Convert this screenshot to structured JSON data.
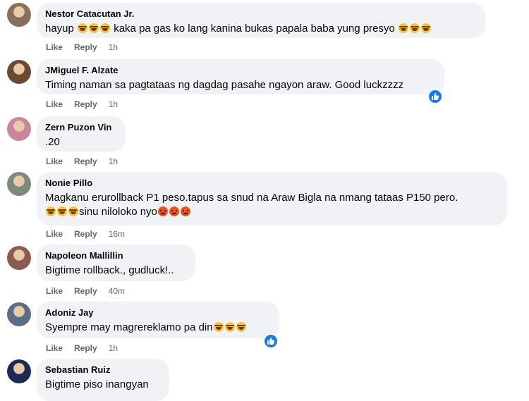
{
  "comments": [
    {
      "author": "Nestor Catacutan Jr.",
      "segments": [
        {
          "type": "text",
          "value": "hayup "
        },
        {
          "type": "emoji",
          "value": "laugh"
        },
        {
          "type": "emoji",
          "value": "laugh"
        },
        {
          "type": "emoji",
          "value": "laugh"
        },
        {
          "type": "text",
          "value": " kaka pa gas ko lang kanina bukas papala baba yung presyo "
        },
        {
          "type": "emoji",
          "value": "laugh"
        },
        {
          "type": "emoji",
          "value": "laugh"
        },
        {
          "type": "emoji",
          "value": "laugh"
        }
      ],
      "like_label": "Like",
      "reply_label": "Reply",
      "time": "1h",
      "reaction": null,
      "avatar_color": "#8a6e5c"
    },
    {
      "author": "JMiguel F. Alzate",
      "segments": [
        {
          "type": "text",
          "value": "Timing naman sa pagtataas ng dagdag pasahe ngayon araw. Good luckzzzz"
        }
      ],
      "like_label": "Like",
      "reply_label": "Reply",
      "time": "1h",
      "reaction": "like-icon",
      "avatar_color": "#6b4a35"
    },
    {
      "author": "Zern Puzon Vin",
      "segments": [
        {
          "type": "text",
          "value": ".20"
        }
      ],
      "like_label": "Like",
      "reply_label": "Reply",
      "time": "1h",
      "reaction": null,
      "avatar_color": "#c9869b"
    },
    {
      "author": "Nonie Pillo",
      "segments": [
        {
          "type": "text",
          "value": "Magkanu erurollback P1 peso.tapus sa snud na Araw Bigla na nmang tataas P150 pero."
        },
        {
          "type": "break"
        },
        {
          "type": "emoji",
          "value": "laugh"
        },
        {
          "type": "emoji",
          "value": "laugh"
        },
        {
          "type": "emoji",
          "value": "laugh"
        },
        {
          "type": "text",
          "value": "sinu niloloko nyo"
        },
        {
          "type": "emoji",
          "value": "angry"
        },
        {
          "type": "emoji",
          "value": "angry"
        },
        {
          "type": "emoji",
          "value": "angry"
        }
      ],
      "like_label": "Like",
      "reply_label": "Reply",
      "time": "16m",
      "reaction": null,
      "avatar_color": "#7b8a7a"
    },
    {
      "author": "Napoleon Mallillin",
      "segments": [
        {
          "type": "text",
          "value": "Bigtime rollback., gudluck!.."
        }
      ],
      "like_label": "Like",
      "reply_label": "Reply",
      "time": "40m",
      "reaction": null,
      "avatar_color": "#8c5a4e"
    },
    {
      "author": "Adoniz Jay",
      "segments": [
        {
          "type": "text",
          "value": "Syempre may magrereklamo pa din"
        },
        {
          "type": "emoji",
          "value": "laugh"
        },
        {
          "type": "emoji",
          "value": "laugh"
        },
        {
          "type": "emoji",
          "value": "laugh"
        }
      ],
      "like_label": "Like",
      "reply_label": "Reply",
      "time": "1h",
      "reaction": "like-icon",
      "avatar_color": "#5a6f86"
    },
    {
      "author": "Sebastian Ruiz",
      "segments": [
        {
          "type": "text",
          "value": "Bigtime piso inangyan"
        }
      ],
      "like_label": "",
      "reply_label": "",
      "time": "",
      "reaction": null,
      "avatar_color": "#1c2a5a"
    }
  ],
  "colors": {
    "bubble": "#f0f2f5",
    "meta_text": "#65676b",
    "like_blue": "#1877f2"
  }
}
